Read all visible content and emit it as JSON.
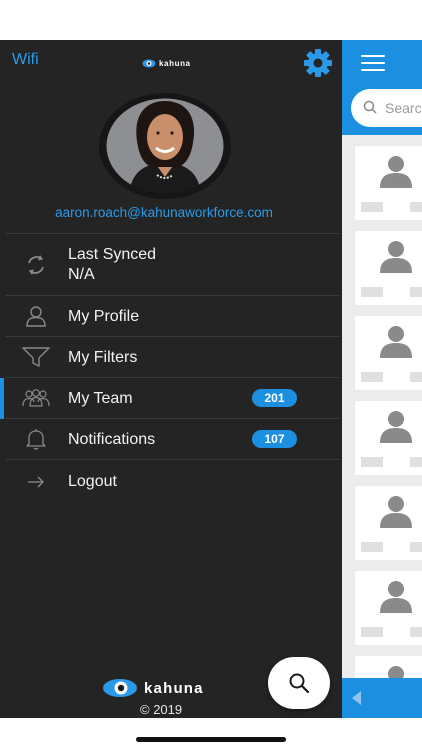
{
  "header": {
    "wifi_label": "Wifi",
    "logo_text": "kahuna",
    "settings_icon": "gear-icon"
  },
  "profile": {
    "email": "aaron.roach@kahunaworkforce.com"
  },
  "menu": {
    "items": [
      {
        "label": "Last Synced",
        "sub": "N/A",
        "icon": "sync-icon"
      },
      {
        "label": "My Profile",
        "icon": "user-icon"
      },
      {
        "label": "My Filters",
        "icon": "filter-icon"
      },
      {
        "label": "My Team",
        "icon": "team-icon",
        "badge": "201"
      },
      {
        "label": "Notifications",
        "icon": "bell-icon",
        "badge": "107"
      },
      {
        "label": "Logout",
        "icon": "arrow-right-icon"
      }
    ]
  },
  "footer": {
    "logo_text": "kahuna",
    "copyright": "© 2019"
  },
  "background_app": {
    "search_placeholder": "Search"
  },
  "colors": {
    "accent": "#1d8fe0",
    "drawer_bg": "#242424"
  }
}
